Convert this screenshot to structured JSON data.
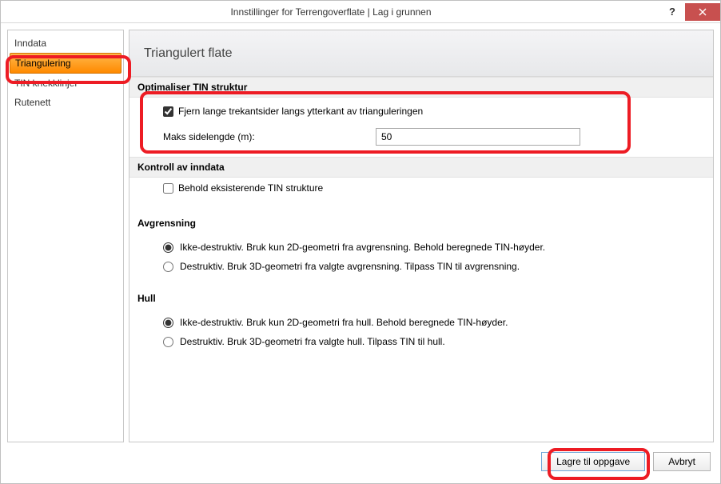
{
  "window": {
    "title": "Innstillinger for Terrengoverflate  |  Lag i grunnen"
  },
  "sidebar": {
    "items": [
      {
        "label": "Inndata",
        "selected": false
      },
      {
        "label": "Triangulering",
        "selected": true
      },
      {
        "label": "TIN knekklinjer",
        "selected": false
      },
      {
        "label": "Rutenett",
        "selected": false
      }
    ]
  },
  "main": {
    "heading": "Triangulert flate",
    "optimize_section": {
      "title": "Optimaliser TIN struktur",
      "remove_long_sides": {
        "label": "Fjern lange trekantsider langs ytterkant av trianguleringen",
        "checked": true
      },
      "max_side_length": {
        "label": "Maks sidelengde (m):",
        "value": "50"
      }
    },
    "control_section": {
      "title": "Kontroll av inndata",
      "keep_existing": {
        "label": "Behold eksisterende TIN strukture",
        "checked": false
      },
      "avgrensning": {
        "title": "Avgrensning",
        "options": [
          {
            "label": "Ikke-destruktiv. Bruk kun 2D-geometri fra avgrensning. Behold beregnede TIN-høyder.",
            "checked": true
          },
          {
            "label": "Destruktiv. Bruk 3D-geometri fra valgte avgrensning. Tilpass TIN til avgrensning.",
            "checked": false
          }
        ]
      },
      "hull": {
        "title": "Hull",
        "options": [
          {
            "label": "Ikke-destruktiv. Bruk kun 2D-geometri fra hull. Behold beregnede TIN-høyder.",
            "checked": true
          },
          {
            "label": "Destruktiv. Bruk 3D-geometri fra valgte hull. Tilpass TIN til hull.",
            "checked": false
          }
        ]
      }
    }
  },
  "footer": {
    "save_label": "Lagre til oppgave",
    "cancel_label": "Avbryt"
  }
}
